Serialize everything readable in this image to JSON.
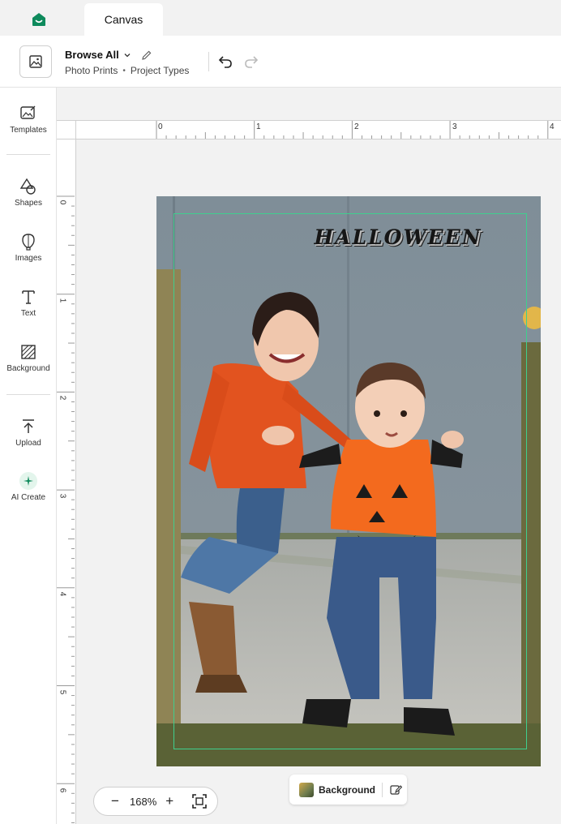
{
  "tabs": [
    {
      "label": "Canvas"
    }
  ],
  "toolbar": {
    "browse_label": "Browse All",
    "crumbs": [
      "Photo Prints",
      "Project Types"
    ]
  },
  "sidebar": {
    "items": [
      {
        "label": "Templates",
        "icon": "templates-icon"
      },
      {
        "label": "Shapes",
        "icon": "shapes-icon"
      },
      {
        "label": "Images",
        "icon": "images-icon"
      },
      {
        "label": "Text",
        "icon": "text-icon"
      },
      {
        "label": "Background",
        "icon": "background-icon"
      },
      {
        "label": "Upload",
        "icon": "upload-icon"
      },
      {
        "label": "AI Create",
        "icon": "ai-create-icon"
      }
    ]
  },
  "ruler": {
    "top_labels": [
      "0",
      "1",
      "2",
      "3",
      "4"
    ],
    "left_labels": [
      "0",
      "1",
      "2",
      "3",
      "4",
      "5",
      "6"
    ]
  },
  "canvas": {
    "headline": "HALLOWEEN"
  },
  "background_chip": {
    "label": "Background"
  },
  "zoom": {
    "value": "168%"
  },
  "colors": {
    "accent": "#0e8a5c",
    "trim_line": "#3fcf8e"
  }
}
